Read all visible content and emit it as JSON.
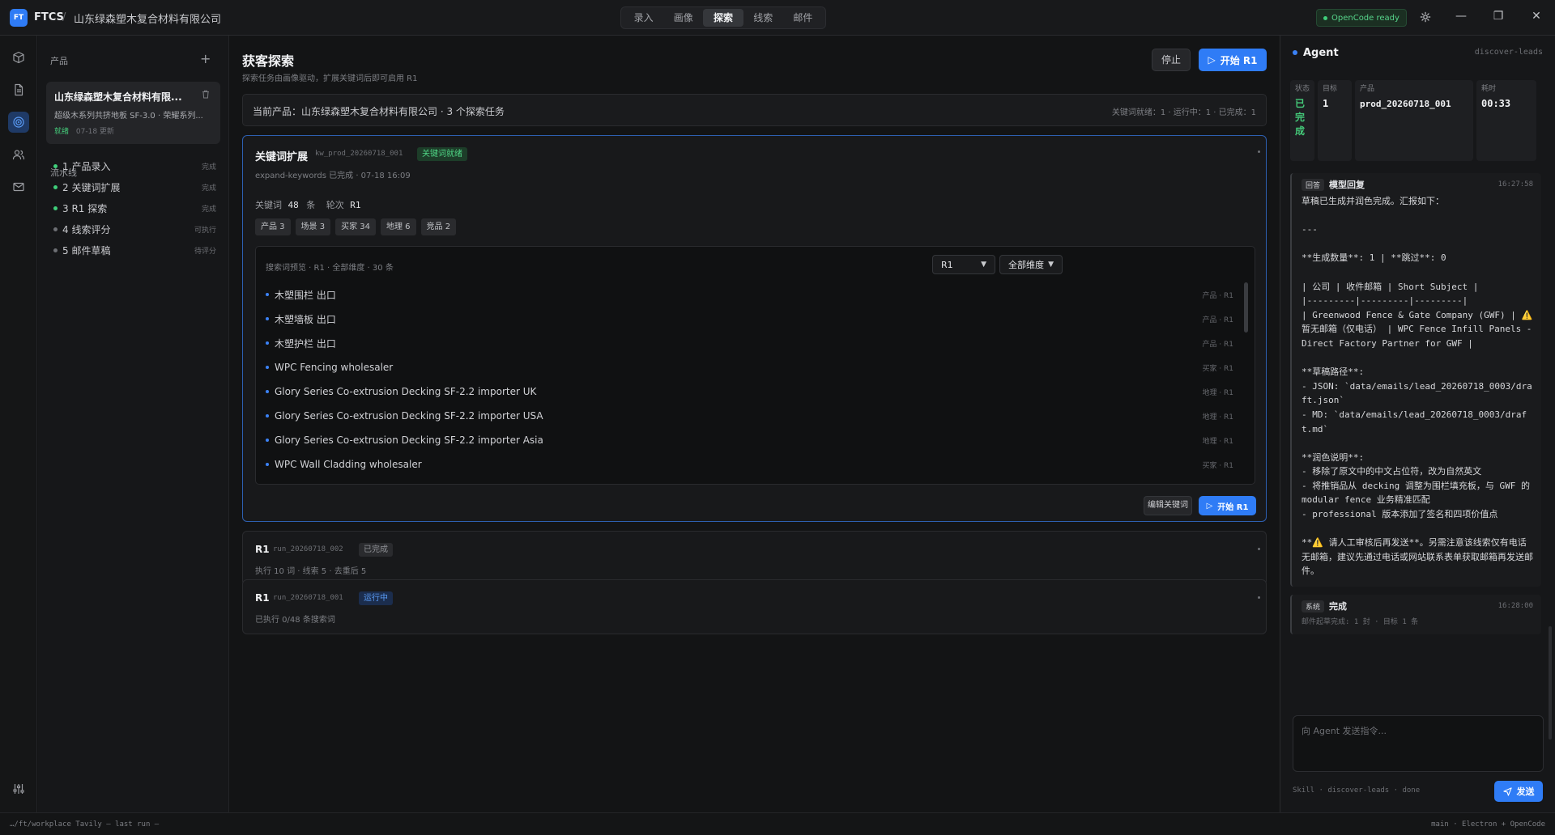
{
  "titlebar": {
    "logo": "FT",
    "app_name": "FTCS",
    "separator": "/",
    "company": "山东绿森塑木复合材料有限公司",
    "nav_tabs": [
      "录入",
      "画像",
      "探索",
      "线索",
      "邮件"
    ],
    "active_tab": "探索",
    "opencode_status": "OpenCode ready",
    "minimize": "—",
    "maximize": "❐",
    "close": "✕"
  },
  "sidebar": {
    "products_header": "产品",
    "add": "+",
    "product": {
      "title": "山东绿森塑木复合材料有限...",
      "description": "超级木系列共挤地板 SF-3.0 · 荣耀系列...",
      "status": "就绪",
      "updated": "07-18 更新"
    },
    "pipeline_header": "流水线",
    "pipeline": [
      {
        "label": "1 产品录入",
        "status": "完成",
        "color": "#3fcf7a"
      },
      {
        "label": "2 关键词扩展",
        "status": "完成",
        "color": "#3fcf7a"
      },
      {
        "label": "3 R1 探索",
        "status": "完成",
        "color": "#3fcf7a"
      },
      {
        "label": "4 线索评分",
        "status": "可执行",
        "color": "#6d6f74"
      },
      {
        "label": "5 邮件草稿",
        "status": "待评分",
        "color": "#6d6f74"
      }
    ]
  },
  "main": {
    "title": "获客探索",
    "subtitle": "探索任务由画像驱动，扩展关键词后即可启用 R1",
    "stop_label": "停止",
    "start_label": "开始 R1",
    "current_product": "当前产品：山东绿森塑木复合材料有限公司 · 3 个探索任务",
    "current_status": "关键词就绪：1 · 运行中：1 · 已完成：1",
    "keyword_card": {
      "title": "关键词扩展",
      "id": "kw_prod_20260718_001",
      "badge": "关键词就绪",
      "subtitle": "expand-keywords 已完成 · 07-18 16:09",
      "keywords_label": "关键词",
      "keywords_count": "48",
      "keywords_unit": "条",
      "round_label": "轮次",
      "round_value": "R1",
      "chips": [
        "产品 3",
        "场景 3",
        "买家 34",
        "地理 6",
        "竞品 2"
      ],
      "preview_header": "搜索词预览 · R1 · 全部维度 · 30 条",
      "round_select": "R1",
      "dim_select": "全部维度",
      "rows": [
        {
          "text": "木塑围栏 出口",
          "tag": "产品 · R1"
        },
        {
          "text": "木塑墙板 出口",
          "tag": "产品 · R1"
        },
        {
          "text": "木塑护栏 出口",
          "tag": "产品 · R1"
        },
        {
          "text": "WPC Fencing wholesaler",
          "tag": "买家 · R1"
        },
        {
          "text": "Glory Series Co-extrusion Decking SF-2.2 importer UK",
          "tag": "地理 · R1"
        },
        {
          "text": "Glory Series Co-extrusion Decking SF-2.2 importer USA",
          "tag": "地理 · R1"
        },
        {
          "text": "Glory Series Co-extrusion Decking SF-2.2 importer Asia",
          "tag": "地理 · R1"
        },
        {
          "text": "WPC Wall Cladding wholesaler",
          "tag": "买家 · R1"
        }
      ],
      "edit_label": "编辑关键词",
      "start_label": "开始 R1"
    },
    "runs": [
      {
        "title": "R1",
        "id": "run_20260718_002",
        "badge": "已完成",
        "state": "done",
        "subtitle": "执行 10 词 · 线索 5 · 去重后 5"
      },
      {
        "title": "R1",
        "id": "run_20260718_001",
        "badge": "运行中",
        "state": "running",
        "subtitle": "已执行 0/48 条搜索词"
      }
    ]
  },
  "agent": {
    "title": "Agent",
    "skill": "discover-leads",
    "stats": [
      {
        "label": "状态",
        "value": "已完成",
        "green": true
      },
      {
        "label": "目标",
        "value": "1"
      },
      {
        "label": "产品",
        "value": "prod_20260718_001"
      },
      {
        "label": "耗时",
        "value": "00:33"
      }
    ],
    "messages": [
      {
        "tag": "回答",
        "name": "模型回复",
        "time": "16:27:58",
        "body": "草稿已生成并润色完成。汇报如下：\n\n---\n\n**生成数量**: 1 | **跳过**: 0\n\n| 公司 | 收件邮箱 | Short Subject |\n|---------|---------|---------|\n| Greenwood Fence & Gate Company (GWF) | ⚠️ 暂无邮箱（仅电话） | WPC Fence Infill Panels - Direct Factory Partner for GWF |\n\n**草稿路径**:\n- JSON: `data/emails/lead_20260718_0003/draft.json`\n- MD: `data/emails/lead_20260718_0003/draft.md`\n\n**润色说明**:\n- 移除了原文中的中文占位符，改为自然英文\n- 将推销品从 decking 调整为围栏填充板，与 GWF 的 modular fence 业务精准匹配\n- professional 版本添加了签名和四项价值点\n\n**⚠️ 请人工审核后再发送**。另需注意该线索仅有电话无邮箱，建议先通过电话或网站联系表单获取邮箱再发送邮件。"
      },
      {
        "tag": "系统",
        "name": "完成",
        "time": "16:28:00",
        "sys": "邮件起草完成: 1 封 · 目标 1 条"
      }
    ],
    "input_placeholder": "向 Agent 发送指令...",
    "footer": "Skill · discover-leads · done",
    "send_label": "发送"
  },
  "statusbar": {
    "left": "…/ft/workplace  Tavily —  last run —",
    "right": "main · Electron + OpenCode"
  }
}
